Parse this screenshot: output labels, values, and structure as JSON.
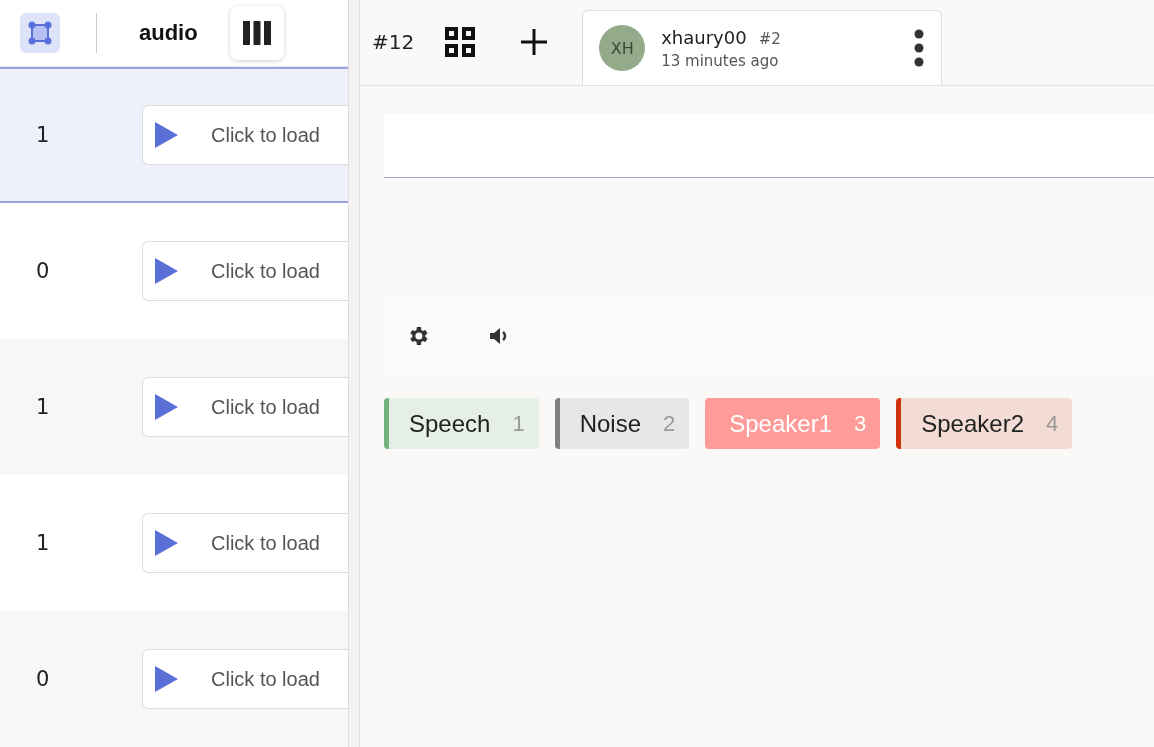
{
  "sidebar": {
    "column_header": "audio",
    "rows": [
      {
        "value": "1",
        "audio_button": "Click to load",
        "selected": true
      },
      {
        "value": "0",
        "audio_button": "Click to load",
        "selected": false
      },
      {
        "value": "1",
        "audio_button": "Click to load",
        "selected": false
      },
      {
        "value": "1",
        "audio_button": "Click to load",
        "selected": false
      },
      {
        "value": "0",
        "audio_button": "Click to load",
        "selected": false
      }
    ]
  },
  "topbar": {
    "task_id": "#12",
    "annotation_tab": {
      "initials": "XH",
      "user": "xhaury00",
      "number": "#2",
      "time": "13 minutes ago"
    }
  },
  "labels": [
    {
      "name": "Speech",
      "hotkey": "1",
      "color": "#71b37e",
      "selected": false
    },
    {
      "name": "Noise",
      "hotkey": "2",
      "color": "#808080",
      "selected": false
    },
    {
      "name": "Speaker1",
      "hotkey": "3",
      "color": "#ff9c99",
      "selected": true
    },
    {
      "name": "Speaker2",
      "hotkey": "4",
      "color": "#d1330f",
      "selected": false
    }
  ]
}
